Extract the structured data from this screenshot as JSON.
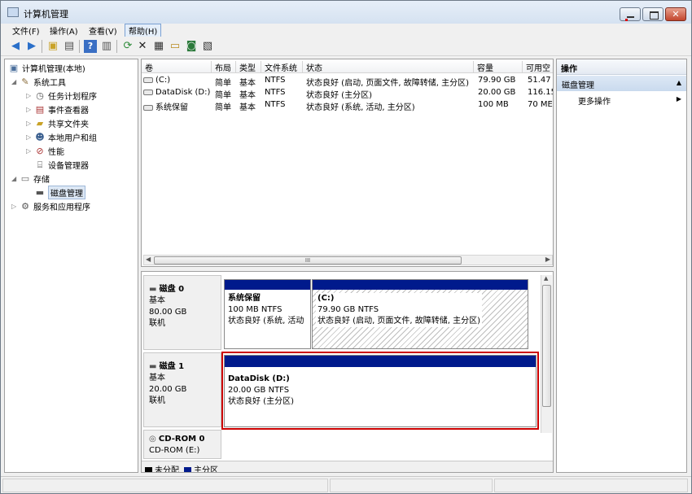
{
  "window": {
    "title": "计算机管理"
  },
  "menu": [
    "文件(F)",
    "操作(A)",
    "查看(V)",
    "帮助(H)"
  ],
  "toolbar": {
    "icons": [
      "back-arrow-icon",
      "forward-arrow-icon",
      "up-folder-icon",
      "show-hide-tree-icon",
      "help-icon",
      "show-hide-action-icon",
      "refresh-icon",
      "delete-icon",
      "properties-icon",
      "open-folder-icon",
      "search-disk-icon",
      "disk-settings-icon"
    ]
  },
  "tree": {
    "root": "计算机管理(本地)",
    "system_tools": "系统工具",
    "task_scheduler": "任务计划程序",
    "event_viewer": "事件查看器",
    "shared_folders": "共享文件夹",
    "local_users": "本地用户和组",
    "performance": "性能",
    "device_manager": "设备管理器",
    "storage": "存储",
    "disk_management": "磁盘管理",
    "services_apps": "服务和应用程序"
  },
  "volumes": {
    "columns": [
      "卷",
      "布局",
      "类型",
      "文件系统",
      "状态",
      "容量",
      "可用空"
    ],
    "rows": [
      {
        "name": "(C:)",
        "layout": "简单",
        "type": "基本",
        "fs": "NTFS",
        "status": "状态良好 (启动, 页面文件, 故障转储, 主分区)",
        "capacity": "79.90 GB",
        "free": "51.47"
      },
      {
        "name": "DataDisk (D:)",
        "layout": "简单",
        "type": "基本",
        "fs": "NTFS",
        "status": "状态良好 (主分区)",
        "capacity": "20.00 GB",
        "free": "116.15"
      },
      {
        "name": "系统保留",
        "layout": "简单",
        "type": "基本",
        "fs": "NTFS",
        "status": "状态良好 (系统, 活动, 主分区)",
        "capacity": "100 MB",
        "free": "70 ME"
      }
    ],
    "hscroll_thumb": "III"
  },
  "disks": [
    {
      "name": "磁盘 0",
      "kind": "基本",
      "size": "80.00 GB",
      "state": "联机",
      "partitions": [
        {
          "name": "系统保留",
          "size": "100 MB NTFS",
          "status": "状态良好 (系统, 活动"
        },
        {
          "name": "(C:)",
          "size": "79.90 GB NTFS",
          "status": "状态良好 (启动, 页面文件, 故障转储, 主分区)"
        }
      ]
    },
    {
      "name": "磁盘 1",
      "kind": "基本",
      "size": "20.00 GB",
      "state": "联机",
      "partitions": [
        {
          "name": "DataDisk  (D:)",
          "size": "20.00 GB NTFS",
          "status": "状态良好 (主分区)"
        }
      ]
    },
    {
      "name": "CD-ROM 0",
      "kind": "CD-ROM (E:)"
    }
  ],
  "legend": [
    {
      "label": "未分配",
      "color": "#000000"
    },
    {
      "label": "主分区",
      "color": "#001a8c"
    }
  ],
  "actions": {
    "header": "操作",
    "section": "磁盘管理",
    "more": "更多操作"
  },
  "colors": {
    "highlight": "#cc0000",
    "primary_partition": "#001a8c"
  }
}
